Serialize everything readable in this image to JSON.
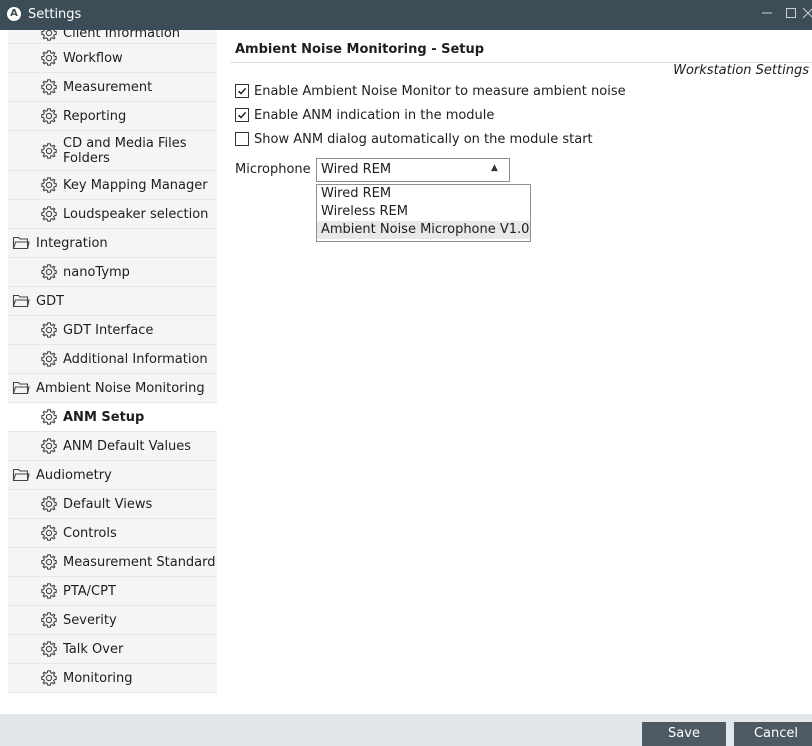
{
  "window": {
    "title": "Settings",
    "logo_letter": "A"
  },
  "sidebar": {
    "items": [
      {
        "kind": "sub",
        "label": "Client Information",
        "partial": true
      },
      {
        "kind": "sub",
        "label": "Workflow"
      },
      {
        "kind": "sub",
        "label": "Measurement"
      },
      {
        "kind": "sub",
        "label": "Reporting"
      },
      {
        "kind": "sub",
        "label": "CD and Media Files Folders",
        "line1": "CD and Media Files",
        "line2": "Folders"
      },
      {
        "kind": "sub",
        "label": "Key Mapping Manager"
      },
      {
        "kind": "sub",
        "label": "Loudspeaker selection"
      },
      {
        "kind": "folder",
        "label": "Integration"
      },
      {
        "kind": "sub",
        "label": "nanoTymp"
      },
      {
        "kind": "folder",
        "label": "GDT"
      },
      {
        "kind": "sub",
        "label": "GDT Interface"
      },
      {
        "kind": "sub",
        "label": "Additional Information"
      },
      {
        "kind": "folder",
        "label": "Ambient Noise Monitoring"
      },
      {
        "kind": "sub",
        "label": "ANM Setup",
        "selected": true
      },
      {
        "kind": "sub",
        "label": "ANM Default Values"
      },
      {
        "kind": "folder",
        "label": "Audiometry"
      },
      {
        "kind": "sub",
        "label": "Default Views"
      },
      {
        "kind": "sub",
        "label": "Controls"
      },
      {
        "kind": "sub",
        "label": "Measurement Standard"
      },
      {
        "kind": "sub",
        "label": "PTA/CPT"
      },
      {
        "kind": "sub",
        "label": "Severity"
      },
      {
        "kind": "sub",
        "label": "Talk Over"
      },
      {
        "kind": "sub",
        "label": "Monitoring"
      }
    ]
  },
  "main": {
    "title": "Ambient Noise Monitoring - Setup",
    "scope": "Workstation Settings",
    "options": [
      {
        "label": "Enable Ambient Noise Monitor to measure ambient noise",
        "checked": true
      },
      {
        "label": "Enable ANM indication in the module",
        "checked": true
      },
      {
        "label": "Show ANM dialog automatically on the module start",
        "checked": false
      }
    ],
    "microphone": {
      "label": "Microphone",
      "value": "Wired REM",
      "options": [
        "Wired REM",
        "Wireless REM",
        "Ambient Noise Microphone V1.0"
      ],
      "highlighted_option": "Ambient Noise Microphone V1.0"
    }
  },
  "footer": {
    "save_label": "Save",
    "cancel_label": "Cancel"
  },
  "icons": {
    "sub_item": "gear-icon",
    "folder_item": "folder-icon"
  }
}
